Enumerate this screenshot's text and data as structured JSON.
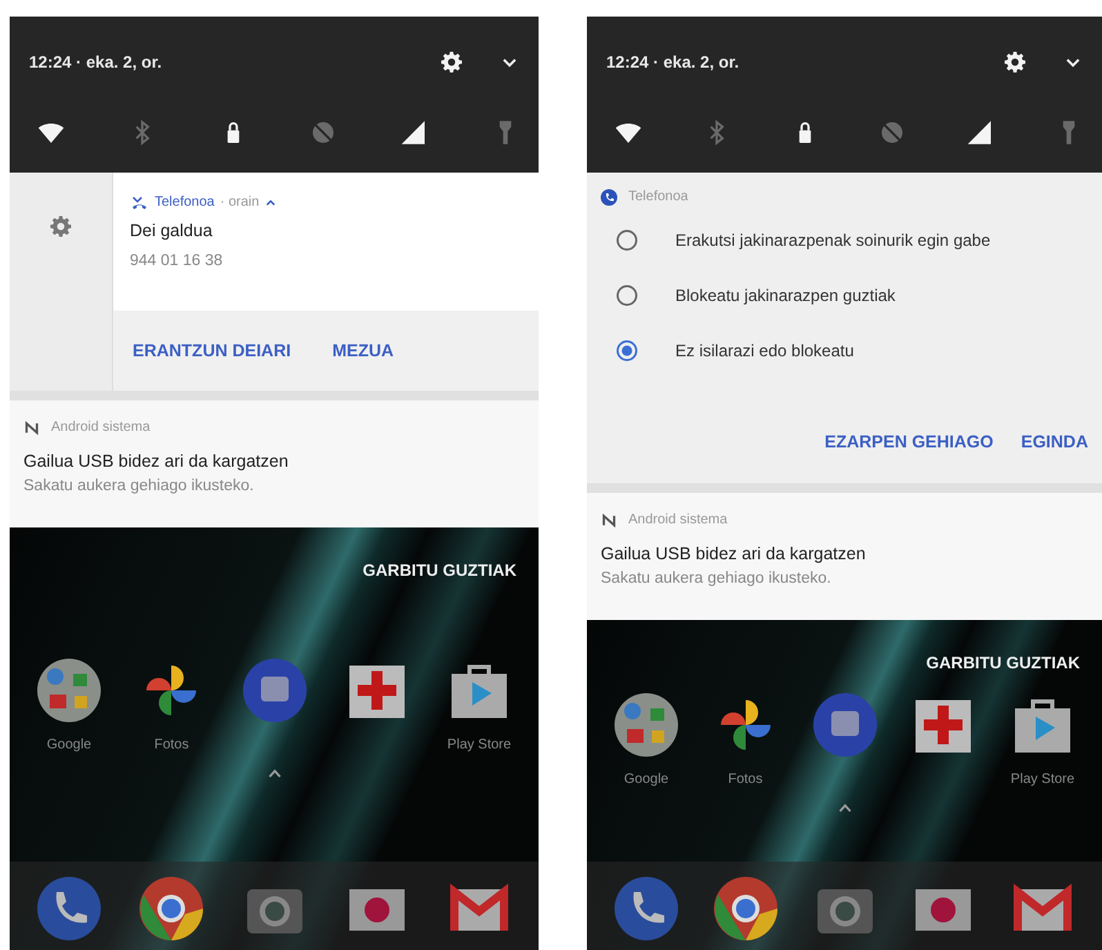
{
  "phones": [
    {
      "status": {
        "datetime": "12:24 · eka. 2, or."
      },
      "quick_settings": [
        {
          "kind": "wifi",
          "on": true
        },
        {
          "kind": "bluetooth",
          "on": false
        },
        {
          "kind": "lock",
          "on": true
        },
        {
          "kind": "dnd",
          "on": false
        },
        {
          "kind": "signal",
          "on": true
        },
        {
          "kind": "flashlight",
          "on": false
        }
      ],
      "notifications": [
        {
          "kind": "expanded",
          "app": "Telefonoa",
          "time": "· orain",
          "title": "Dei galdua",
          "text": "944 01 16 38",
          "actions": [
            "ERANTZUN DEIARI",
            "MEZUA"
          ]
        },
        {
          "kind": "simple",
          "app": "Android sistema",
          "title": "Gailua USB bidez ari da kargatzen",
          "text": "Sakatu aukera gehiago ikusteko."
        }
      ],
      "clear_all": "GARBITU GUZTIAK",
      "apps": [
        {
          "kind": "folder",
          "label": "Google"
        },
        {
          "kind": "pinwheel",
          "label": "Fotos"
        },
        {
          "kind": "chat"
        },
        {
          "kind": "medkit"
        },
        {
          "kind": "store",
          "label": "Play Store"
        }
      ],
      "dock": [
        {
          "kind": "phone"
        },
        {
          "kind": "browser"
        },
        {
          "kind": "camera"
        },
        {
          "kind": "recorder"
        },
        {
          "kind": "mail"
        }
      ]
    },
    {
      "status": {
        "datetime": "12:24 · eka. 2, or."
      },
      "quick_settings": [
        {
          "kind": "wifi",
          "on": true
        },
        {
          "kind": "bluetooth",
          "on": false
        },
        {
          "kind": "lock",
          "on": true
        },
        {
          "kind": "dnd",
          "on": false
        },
        {
          "kind": "signal",
          "on": true
        },
        {
          "kind": "flashlight",
          "on": false
        }
      ],
      "notifications": [
        {
          "kind": "settings",
          "app": "Telefonoa",
          "options": [
            {
              "label": "Erakutsi jakinarazpenak soinurik egin gabe",
              "selected": false
            },
            {
              "label": "Blokeatu jakinarazpen guztiak",
              "selected": false
            },
            {
              "label": "Ez isilarazi edo blokeatu",
              "selected": true
            }
          ],
          "actions": [
            "EZARPEN GEHIAGO",
            "EGINDA"
          ]
        },
        {
          "kind": "simple",
          "app": "Android sistema",
          "title": "Gailua USB bidez ari da kargatzen",
          "text": "Sakatu aukera gehiago ikusteko."
        }
      ],
      "clear_all": "GARBITU GUZTIAK",
      "apps": [
        {
          "kind": "folder",
          "label": "Google"
        },
        {
          "kind": "pinwheel",
          "label": "Fotos"
        },
        {
          "kind": "chat"
        },
        {
          "kind": "medkit"
        },
        {
          "kind": "store",
          "label": "Play Store"
        }
      ],
      "dock": [
        {
          "kind": "phone"
        },
        {
          "kind": "browser"
        },
        {
          "kind": "camera"
        },
        {
          "kind": "recorder"
        },
        {
          "kind": "mail"
        }
      ]
    }
  ]
}
